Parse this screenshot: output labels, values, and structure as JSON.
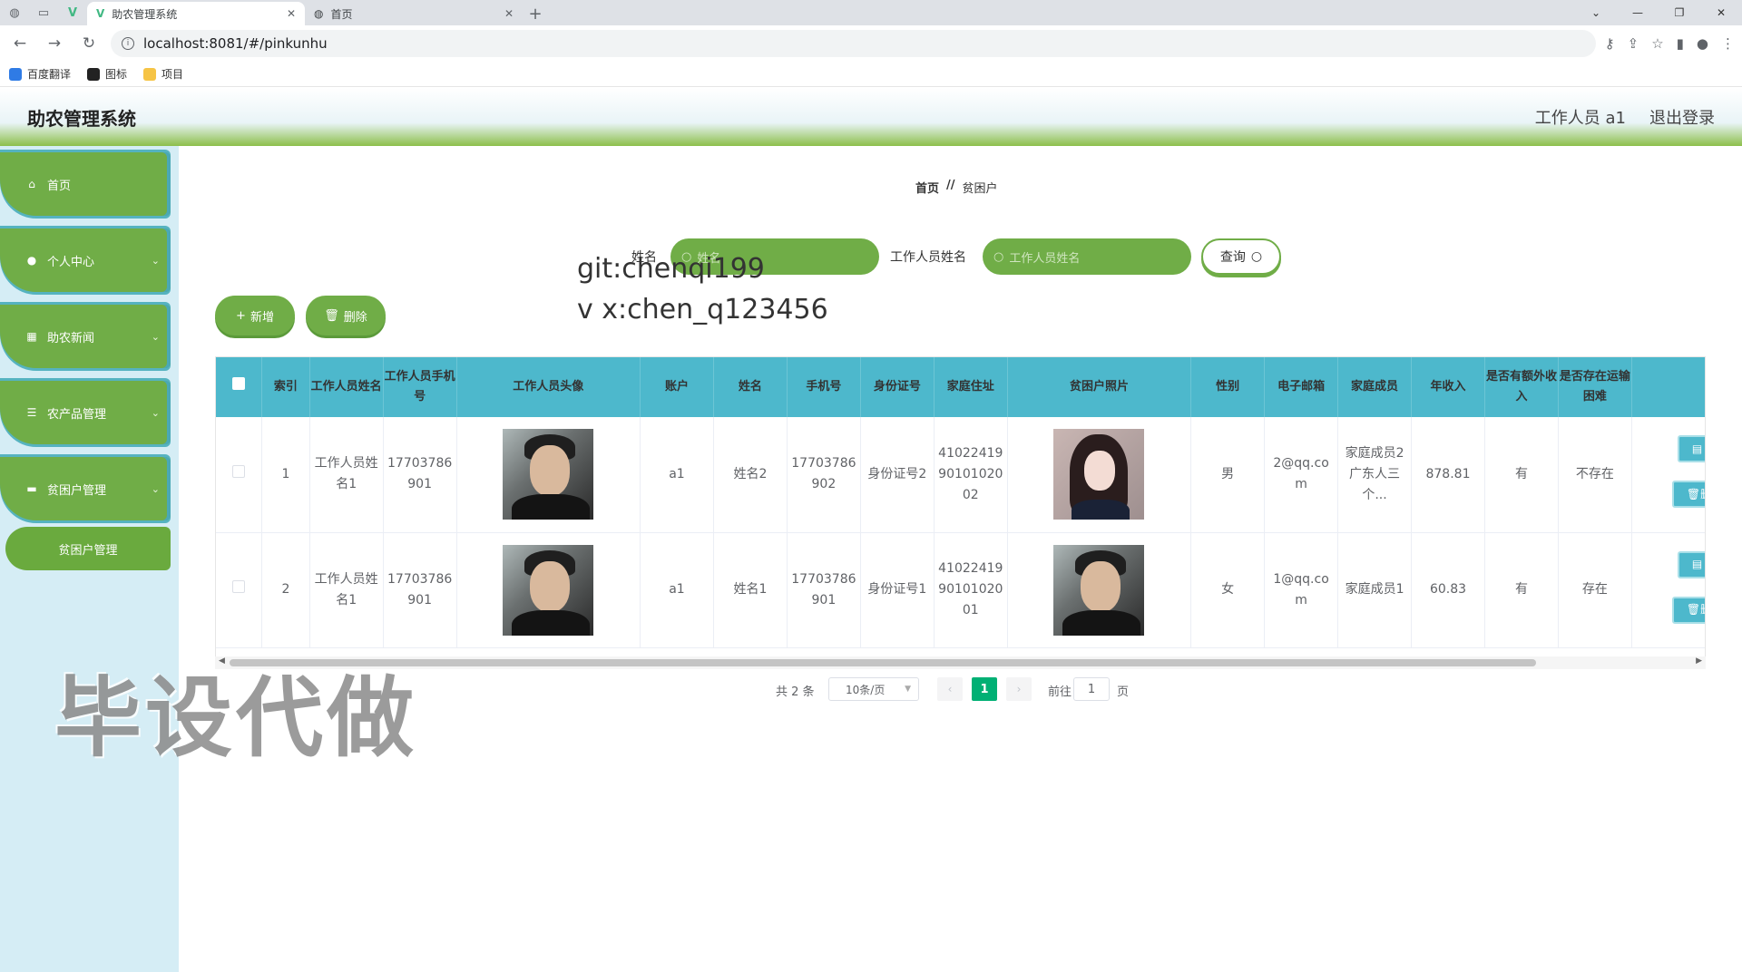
{
  "browser": {
    "tabs": [
      {
        "title": "助农管理系统",
        "active": true
      },
      {
        "title": "首页",
        "active": false
      }
    ],
    "url": "localhost:8081/#/pinkunhu",
    "bookmarks": [
      "百度翻译",
      "图标",
      "项目"
    ]
  },
  "header": {
    "title": "助农管理系统",
    "user": "工作人员 a1",
    "logout": "退出登录"
  },
  "sidebar": {
    "items": [
      {
        "label": "首页",
        "icon": "home-icon"
      },
      {
        "label": "个人中心",
        "icon": "user-icon"
      },
      {
        "label": "助农新闻",
        "icon": "grid-icon"
      },
      {
        "label": "农产品管理",
        "icon": "list-icon"
      },
      {
        "label": "贫困户管理",
        "icon": "monitor-icon"
      }
    ],
    "sub_item": "贫困户管理"
  },
  "breadcrumb": {
    "home": "首页",
    "separator": "//",
    "current": "贫困户"
  },
  "search": {
    "name_label": "姓名",
    "name_placeholder": "姓名",
    "worker_label": "工作人员姓名",
    "worker_placeholder": "工作人员姓名",
    "query_button": "查询"
  },
  "overlay": {
    "line1": "git:chenqi199",
    "line2": "v x:chen_q123456",
    "big": "毕设代做"
  },
  "actions": {
    "add": "新增",
    "delete": "删除"
  },
  "table": {
    "columns": [
      "索引",
      "工作人员姓名",
      "工作人员手机号",
      "工作人员头像",
      "账户",
      "姓名",
      "手机号",
      "身份证号",
      "家庭住址",
      "贫困户照片",
      "性别",
      "电子邮箱",
      "家庭成员",
      "年收入",
      "是否有额外收入",
      "是否存在运输困难"
    ],
    "rows": [
      {
        "index": "1",
        "worker_name": "工作人员姓名1",
        "worker_phone": "17703786901",
        "account": "a1",
        "name": "姓名2",
        "phone": "17703786902",
        "id_card": "身份证号2",
        "address": "410224199010102002",
        "gender": "男",
        "email": "2@qq.com",
        "family": "家庭成员2广东人三个...",
        "income": "878.81",
        "extra_income": "有",
        "transport": "不存在"
      },
      {
        "index": "2",
        "worker_name": "工作人员姓名1",
        "worker_phone": "17703786901",
        "account": "a1",
        "name": "姓名1",
        "phone": "17703786901",
        "id_card": "身份证号1",
        "address": "410224199010102001",
        "gender": "女",
        "email": "1@qq.com",
        "family": "家庭成员1",
        "income": "60.83",
        "extra_income": "有",
        "transport": "存在"
      }
    ],
    "row_delete_label": "删"
  },
  "pagination": {
    "total": "共 2 条",
    "page_size": "10条/页",
    "current": "1",
    "goto_label": "前往",
    "goto_value": "1",
    "page_unit": "页"
  },
  "colors": {
    "green": "#70ad47",
    "teal": "#4db8cc",
    "active_page": "#00b074"
  }
}
